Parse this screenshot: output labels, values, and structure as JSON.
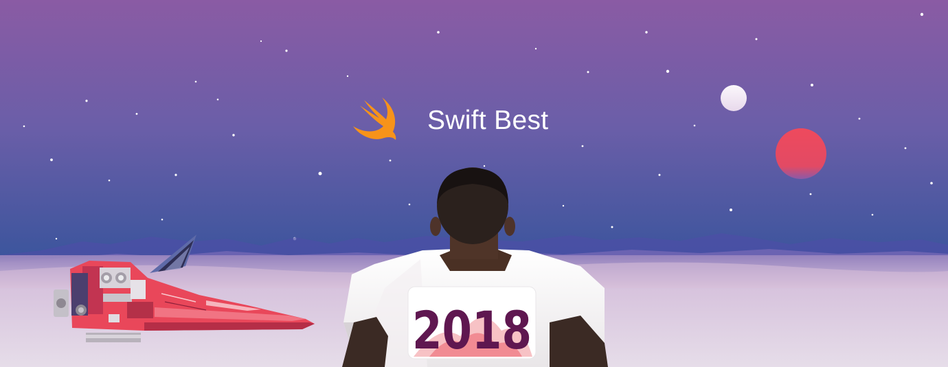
{
  "banner": {
    "title": "Swift Best",
    "year_badge": "2018"
  },
  "logo": {
    "icon": "swift-bird-icon",
    "color": "#f7931a"
  },
  "colors": {
    "sky_top": "#8b5aa4",
    "sky_bottom": "#34519a",
    "red_planet": "#ec4a5e",
    "white_moon": "#f4eef6",
    "ground": "#e4dbe8",
    "spaceship": "#e9475a",
    "badge_text": "#5f1750"
  }
}
